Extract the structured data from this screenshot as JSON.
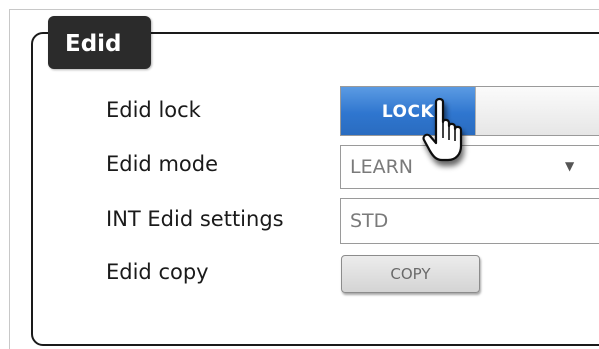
{
  "panel": {
    "title": "Edid"
  },
  "rows": {
    "lock": {
      "label": "Edid lock",
      "on_label": "LOCK"
    },
    "mode": {
      "label": "Edid mode",
      "selected": "LEARN"
    },
    "int": {
      "label": "INT Edid settings",
      "value": "STD"
    },
    "copy": {
      "label": "Edid copy",
      "button_label": "COPY"
    }
  },
  "icons": {
    "cursor": "hand-pointer-icon",
    "dropdown": "dropdown-arrow-icon"
  },
  "colors": {
    "accent": "#2f76cf",
    "title_bg": "#2b2b2b"
  }
}
